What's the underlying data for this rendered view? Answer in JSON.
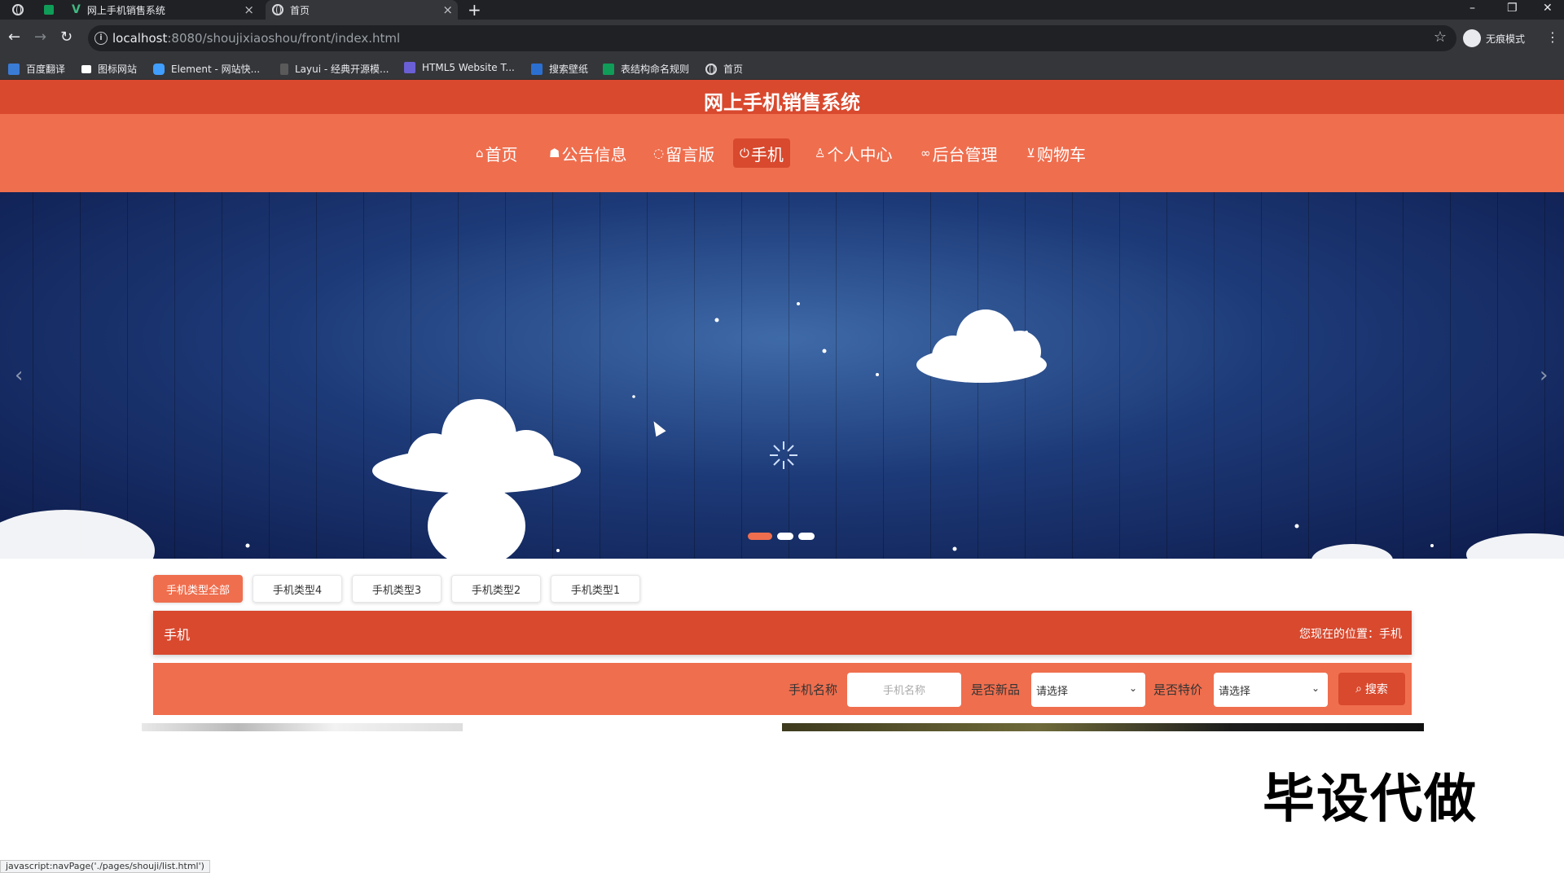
{
  "browser": {
    "tabs": [
      {
        "title": "网上手机销售系统",
        "active": false
      },
      {
        "title": "首页",
        "active": true
      }
    ],
    "url_host": "localhost",
    "url_path": ":8080/shoujixiaoshou/front/index.html",
    "profile_label": "无痕模式",
    "bookmarks": [
      "百度翻译",
      "图标网站",
      "Element - 网站快...",
      "Layui - 经典开源模...",
      "HTML5 Website T...",
      "搜索壁纸",
      "表结构命名规则",
      "首页"
    ],
    "status_url": "javascript:navPage('./pages/shouji/list.html')"
  },
  "site": {
    "title": "网上手机销售系统",
    "nav": [
      {
        "label": "首页",
        "icon": "home-icon",
        "active": false
      },
      {
        "label": "公告信息",
        "icon": "graduation-cap-icon",
        "active": false
      },
      {
        "label": "留言版",
        "icon": "chat-icon",
        "active": false
      },
      {
        "label": "手机",
        "icon": "power-icon",
        "active": true
      },
      {
        "label": "个人中心",
        "icon": "user-icon",
        "active": false
      },
      {
        "label": "后台管理",
        "icon": "link-icon",
        "active": false
      },
      {
        "label": "购物车",
        "icon": "cart-icon",
        "active": false
      }
    ],
    "banner": {
      "slides": 3,
      "active_slide": 1
    },
    "categories": [
      {
        "label": "手机类型全部",
        "active": true
      },
      {
        "label": "手机类型4",
        "active": false
      },
      {
        "label": "手机类型3",
        "active": false
      },
      {
        "label": "手机类型2",
        "active": false
      },
      {
        "label": "手机类型1",
        "active": false
      }
    ],
    "section_title": "手机",
    "location_text": "您现在的位置：手机",
    "search": {
      "name_label": "手机名称",
      "name_placeholder": "手机名称",
      "new_label": "是否新品",
      "new_value": "请选择",
      "special_label": "是否特价",
      "special_value": "请选择",
      "button_label": "搜索"
    },
    "watermark": "毕设代做"
  },
  "colors": {
    "primary": "#ef6e4e",
    "primary_dark": "#d8492e"
  }
}
